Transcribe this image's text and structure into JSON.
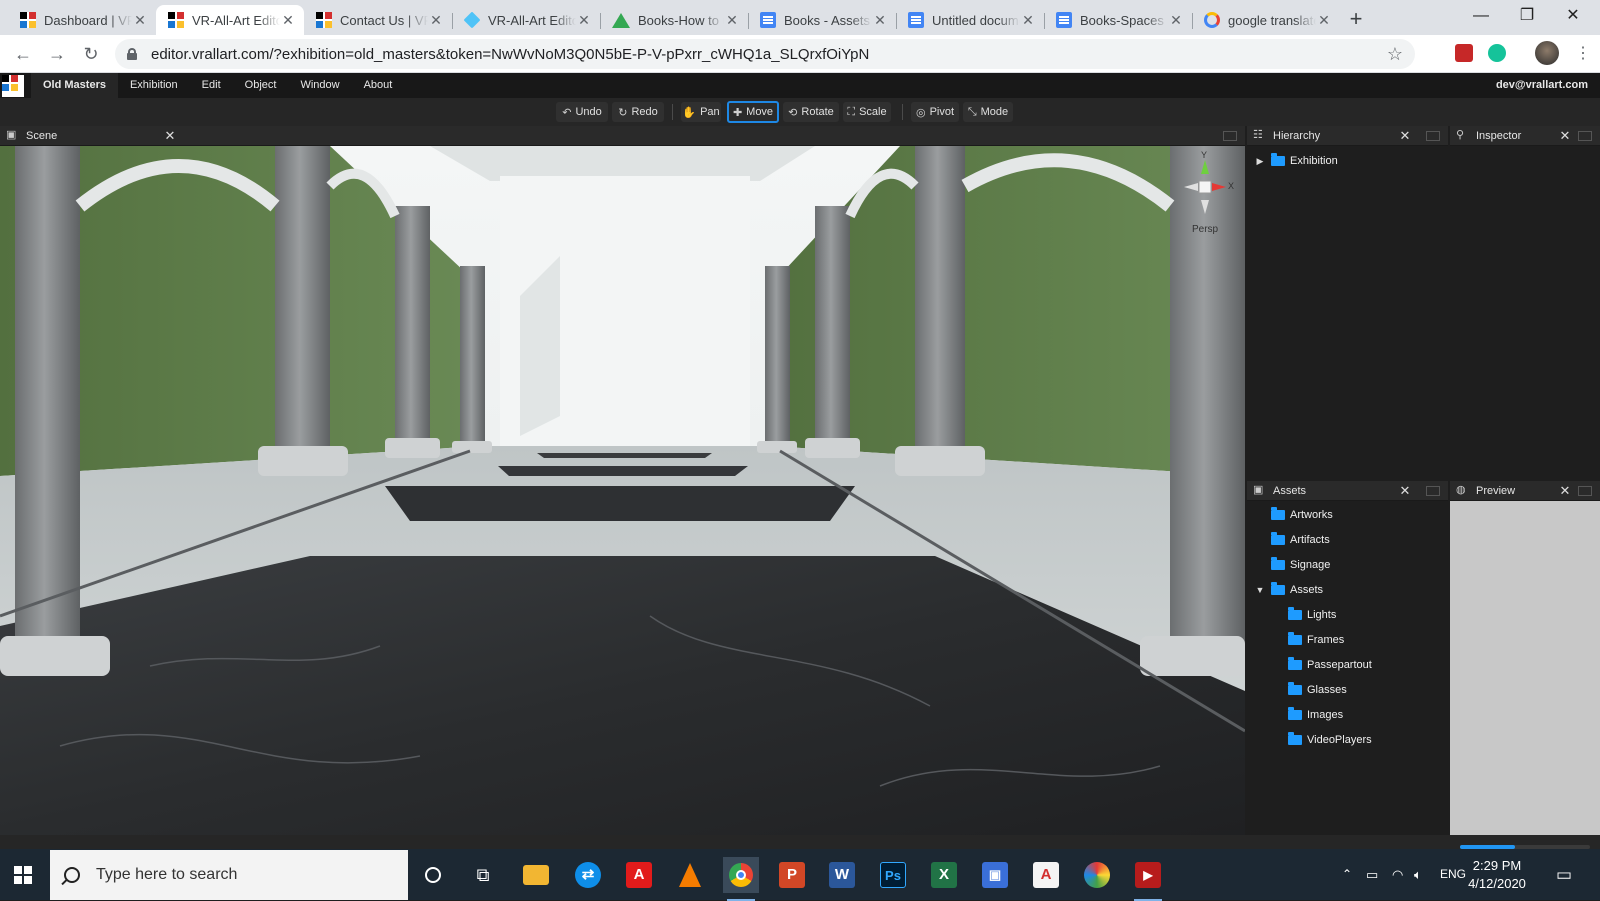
{
  "browser": {
    "tabs": [
      {
        "title": "Dashboard | VR-All-Art",
        "favicon": "vrallart-logo-icon",
        "active": false
      },
      {
        "title": "VR-All-Art Editor",
        "favicon": "vrallart-logo-icon",
        "active": true
      },
      {
        "title": "Contact Us | VR-All-Art",
        "favicon": "vrallart-logo-icon",
        "active": false
      },
      {
        "title": "VR-All-Art Editor",
        "favicon": "cube-icon",
        "active": false
      },
      {
        "title": "Books-How to use",
        "favicon": "google-drive-icon",
        "active": false
      },
      {
        "title": "Books - Assets",
        "favicon": "google-docs-icon",
        "active": false
      },
      {
        "title": "Untitled document",
        "favicon": "google-docs-icon",
        "active": false
      },
      {
        "title": "Books-Spaces",
        "favicon": "google-docs-icon",
        "active": false
      },
      {
        "title": "google translate",
        "favicon": "google-icon",
        "active": false
      }
    ],
    "url": "editor.vrallart.com/?exhibition=old_masters&token=NwWvNoM3Q0N5bE-P-V-pPxrr_cWHQ1a_SLQrxfOiYpN"
  },
  "menubar": {
    "project": "Old Masters",
    "items": [
      "Exhibition",
      "Edit",
      "Object",
      "Window",
      "About"
    ],
    "user": "dev@vrallart.com"
  },
  "toolbar": {
    "undo": "Undo",
    "redo": "Redo",
    "pan": "Pan",
    "move": "Move",
    "rotate": "Rotate",
    "scale": "Scale",
    "pivot": "Pivot",
    "mode": "Mode",
    "active_tool": "Move"
  },
  "panels": {
    "scene": {
      "title": "Scene",
      "gizmo": {
        "y": "Y",
        "x": "X",
        "view": "Persp"
      }
    },
    "hierarchy": {
      "title": "Hierarchy",
      "items": [
        "Exhibition"
      ]
    },
    "inspector": {
      "title": "Inspector"
    },
    "assets": {
      "title": "Assets",
      "items": [
        {
          "label": "Artworks",
          "depth": 0,
          "expanded": false
        },
        {
          "label": "Artifacts",
          "depth": 0,
          "expanded": false
        },
        {
          "label": "Signage",
          "depth": 0,
          "expanded": false
        },
        {
          "label": "Assets",
          "depth": 0,
          "expanded": true
        },
        {
          "label": "Lights",
          "depth": 1,
          "expanded": false
        },
        {
          "label": "Frames",
          "depth": 1,
          "expanded": false
        },
        {
          "label": "Passepartout",
          "depth": 1,
          "expanded": false
        },
        {
          "label": "Glasses",
          "depth": 1,
          "expanded": false
        },
        {
          "label": "Images",
          "depth": 1,
          "expanded": false
        },
        {
          "label": "VideoPlayers",
          "depth": 1,
          "expanded": false
        }
      ]
    },
    "preview": {
      "title": "Preview"
    }
  },
  "status": {
    "load_progress": 0.42
  },
  "taskbar": {
    "search_placeholder": "Type here to search",
    "language": "ENG",
    "time": "2:29 PM",
    "date": "4/12/2020",
    "apps": [
      "cortana-icon",
      "task-view-icon",
      "file-explorer-icon",
      "teamviewer-icon",
      "autocad-icon",
      "vlc-icon",
      "chrome-icon",
      "powerpoint-icon",
      "word-icon",
      "photoshop-icon",
      "excel-icon",
      "save-icon",
      "acrobat-icon",
      "paint-icon",
      "video-editor-icon"
    ]
  },
  "colors": {
    "accent": "#1e88e5",
    "folder": "#1e9bff",
    "wall_green": "#5f7f4e"
  }
}
